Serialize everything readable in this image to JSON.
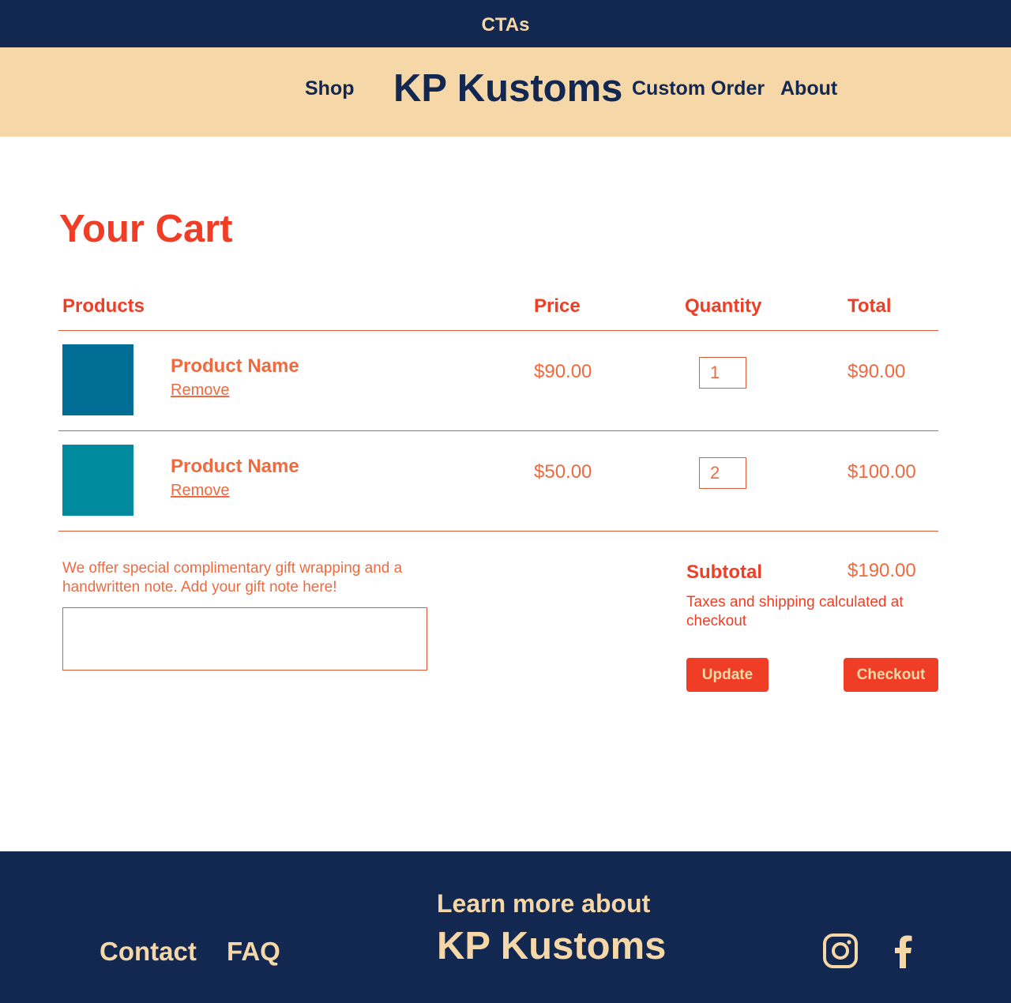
{
  "cta_bar": {
    "text": "CTAs"
  },
  "header": {
    "brand": "KP Kustoms",
    "nav": {
      "shop": "Shop",
      "custom_order": "Custom Order",
      "about": "About"
    }
  },
  "cart": {
    "title": "Your Cart",
    "columns": {
      "products": "Products",
      "price": "Price",
      "quantity": "Quantity",
      "total": "Total"
    },
    "items": [
      {
        "name": "Product Name",
        "remove": "Remove",
        "price": "$90.00",
        "quantity": "1",
        "total": "$90.00",
        "thumb_color": "#006e94"
      },
      {
        "name": "Product Name",
        "remove": "Remove",
        "price": "$50.00",
        "quantity": "2",
        "total": "$100.00",
        "thumb_color": "#008a9e"
      }
    ],
    "gift_text": "We offer special complimentary gift wrapping and a handwritten note. Add your gift note here!",
    "gift_note_value": "",
    "subtotal_label": "Subtotal",
    "subtotal_value": "$190.00",
    "taxes_note": "Taxes and shipping calculated at checkout",
    "update_label": "Update",
    "checkout_label": "Checkout"
  },
  "footer": {
    "contact": "Contact",
    "faq": "FAQ",
    "learn_more": "Learn more about",
    "brand": "KP Kustoms",
    "social": [
      "instagram-icon",
      "facebook-icon"
    ]
  },
  "colors": {
    "navy": "#132851",
    "cream": "#f6d7a7",
    "red": "#ef3e25",
    "orange": "#ef6a3e"
  }
}
